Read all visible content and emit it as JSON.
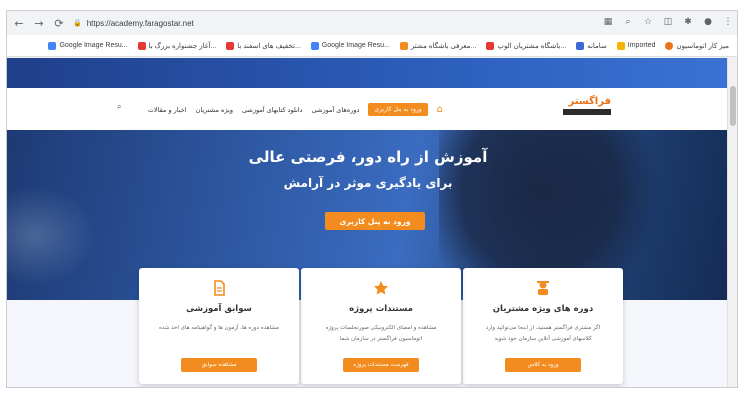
{
  "browser": {
    "url": "https://academy.faragostar.net",
    "bookmarks": [
      "Google Image Resu...",
      "آغاز جشنواره بزرگ با...",
      "تخفیف های اسفند با...",
      "Google Image Resu...",
      "معرفی باشگاه مشتر...",
      "باشگاه مشتریان الوپ...",
      "سامانه",
      "Imported",
      "میز کار اتوماسیون"
    ]
  },
  "site": {
    "logo": "فراگستر",
    "menu": [
      "ورود به پنل کاربری",
      "دوره‌های آموزشی",
      "دانلود کتابهای آموزشی",
      "ویژه مشتریان",
      "اخبار و مقالات"
    ],
    "hero": {
      "title": "آموزش از راه دور، فرصتی عالی",
      "subtitle": "برای یادگیری موثر در آرامش",
      "button": "ورود به پنل کاربری"
    },
    "cards": [
      {
        "title": "دوره های ویژه مشتریان",
        "desc": "اگر مشتری فراگستر هستید، از اینجا می‌توانید وارد کلاسهای آموزشی آنلاین سازمان خود شوید",
        "button": "ورود به کلاس"
      },
      {
        "title": "مستندات پروژه",
        "desc": "مشاهده و امضای الکترونیکی صورتجلسات پروژه اتوماسیون فراگستر در سازمان شما",
        "button": "فهرست مستندات پروژه"
      },
      {
        "title": "سوابق آموزشی",
        "desc": "مشاهده دوره ها، آزمون ها و گواهینامه های اخذ شده",
        "button": "مشاهده سوابق"
      }
    ]
  },
  "colors": {
    "accent": "#f28c1e",
    "heroBlue": "#2f5aa6"
  }
}
